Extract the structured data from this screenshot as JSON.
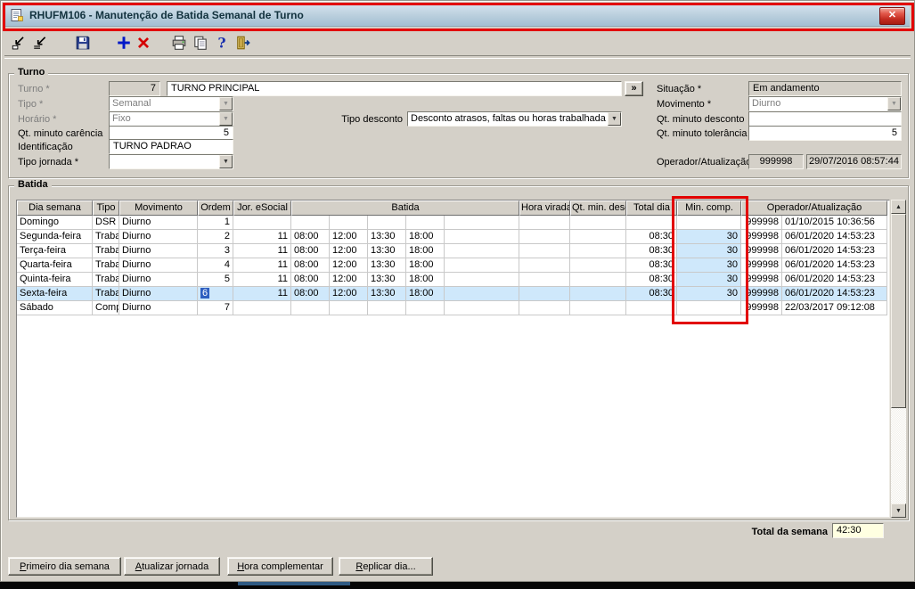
{
  "titlebar": {
    "title": "RHUFM106 - Manutenção de Batida Semanal de Turno"
  },
  "ui": {
    "close_glyph": "✕",
    "dropdown_arrow": "▼",
    "scroll_up": "▲",
    "scroll_down": "▼",
    "lookup_label": "»"
  },
  "toolbar": {
    "icons": [
      "goto-icon",
      "search-icon",
      "save-icon",
      "add-icon",
      "delete-icon",
      "print-icon",
      "copy-icon",
      "help-icon",
      "exit-icon"
    ]
  },
  "turno": {
    "legend": "Turno",
    "labels": {
      "turno": "Turno *",
      "tipo": "Tipo *",
      "horario": "Horário *",
      "tipo_desconto": "Tipo desconto",
      "qt_carencia": "Qt. minuto carência",
      "identificacao": "Identificação",
      "tipo_jornada": "Tipo jornada *",
      "situacao": "Situação *",
      "movimento": "Movimento *",
      "qt_desconto": "Qt. minuto desconto",
      "qt_tolerancia": "Qt. minuto tolerância",
      "operador": "Operador/Atualização"
    },
    "values": {
      "turno_num": "7",
      "turno_nome": "TURNO PRINCIPAL",
      "tipo": "Semanal",
      "horario": "Fixo",
      "tipo_desconto": "Desconto atrasos, faltas ou horas trabalhadas",
      "qt_carencia": "5",
      "identificacao": "TURNO PADRAO",
      "tipo_jornada": "",
      "situacao": "Em andamento",
      "movimento": "Diurno",
      "qt_desconto": "",
      "qt_tolerancia": "5",
      "operador_codigo": "999998",
      "operador_data": "29/07/2016 08:57:44"
    }
  },
  "batida": {
    "legend": "Batida",
    "headers": {
      "dia": "Dia semana",
      "tipo": "Tipo",
      "movimento": "Movimento",
      "ordem": "Ordem",
      "jor_esocial": "Jor. eSocial",
      "batida": "Batida",
      "hora_virada": "Hora virada",
      "qt_min_desc": "Qt. min. desc.",
      "total_dia": "Total dia",
      "min_comp": "Min. comp.",
      "operador": "Operador/Atualização"
    },
    "rows": [
      {
        "dia": "Domingo",
        "tipo": "DSR",
        "movimento": "Diurno",
        "ordem": "1",
        "jor_esocial": "",
        "batidas": [
          "",
          "",
          "",
          ""
        ],
        "hora_virada": "",
        "qt_min_desc": "",
        "total_dia": "",
        "min_comp": "",
        "operador": "999998",
        "atualizacao": "01/10/2015 10:36:56",
        "selected": false,
        "min_comp_highlight": false
      },
      {
        "dia": "Segunda-feira",
        "tipo": "Trabal",
        "movimento": "Diurno",
        "ordem": "2",
        "jor_esocial": "11",
        "batidas": [
          "08:00",
          "12:00",
          "13:30",
          "18:00"
        ],
        "hora_virada": "",
        "qt_min_desc": "",
        "total_dia": "08:30",
        "min_comp": "30",
        "operador": "999998",
        "atualizacao": "06/01/2020 14:53:23",
        "selected": false,
        "min_comp_highlight": true
      },
      {
        "dia": "Terça-feira",
        "tipo": "Trabal",
        "movimento": "Diurno",
        "ordem": "3",
        "jor_esocial": "11",
        "batidas": [
          "08:00",
          "12:00",
          "13:30",
          "18:00"
        ],
        "hora_virada": "",
        "qt_min_desc": "",
        "total_dia": "08:30",
        "min_comp": "30",
        "operador": "999998",
        "atualizacao": "06/01/2020 14:53:23",
        "selected": false,
        "min_comp_highlight": true
      },
      {
        "dia": "Quarta-feira",
        "tipo": "Trabal",
        "movimento": "Diurno",
        "ordem": "4",
        "jor_esocial": "11",
        "batidas": [
          "08:00",
          "12:00",
          "13:30",
          "18:00"
        ],
        "hora_virada": "",
        "qt_min_desc": "",
        "total_dia": "08:30",
        "min_comp": "30",
        "operador": "999998",
        "atualizacao": "06/01/2020 14:53:23",
        "selected": false,
        "min_comp_highlight": true
      },
      {
        "dia": "Quinta-feira",
        "tipo": "Trabal",
        "movimento": "Diurno",
        "ordem": "5",
        "jor_esocial": "11",
        "batidas": [
          "08:00",
          "12:00",
          "13:30",
          "18:00"
        ],
        "hora_virada": "",
        "qt_min_desc": "",
        "total_dia": "08:30",
        "min_comp": "30",
        "operador": "999998",
        "atualizacao": "06/01/2020 14:53:23",
        "selected": false,
        "min_comp_highlight": true
      },
      {
        "dia": "Sexta-feira",
        "tipo": "Trabal",
        "movimento": "Diurno",
        "ordem": "6",
        "jor_esocial": "11",
        "batidas": [
          "08:00",
          "12:00",
          "13:30",
          "18:00"
        ],
        "hora_virada": "",
        "qt_min_desc": "",
        "total_dia": "08:30",
        "min_comp": "30",
        "operador": "999998",
        "atualizacao": "06/01/2020 14:53:23",
        "selected": true,
        "min_comp_highlight": true
      },
      {
        "dia": "Sábado",
        "tipo": "Comp",
        "movimento": "Diurno",
        "ordem": "7",
        "jor_esocial": "",
        "batidas": [
          "",
          "",
          "",
          ""
        ],
        "hora_virada": "",
        "qt_min_desc": "",
        "total_dia": "",
        "min_comp": "",
        "operador": "999998",
        "atualizacao": "22/03/2017 09:12:08",
        "selected": false,
        "min_comp_highlight": false
      }
    ],
    "total": {
      "label": "Total da semana",
      "value": "42:30"
    }
  },
  "footer_buttons": [
    "Primeiro dia semana",
    "Atualizar jornada",
    "Hora complementar",
    "Replicar dia..."
  ]
}
